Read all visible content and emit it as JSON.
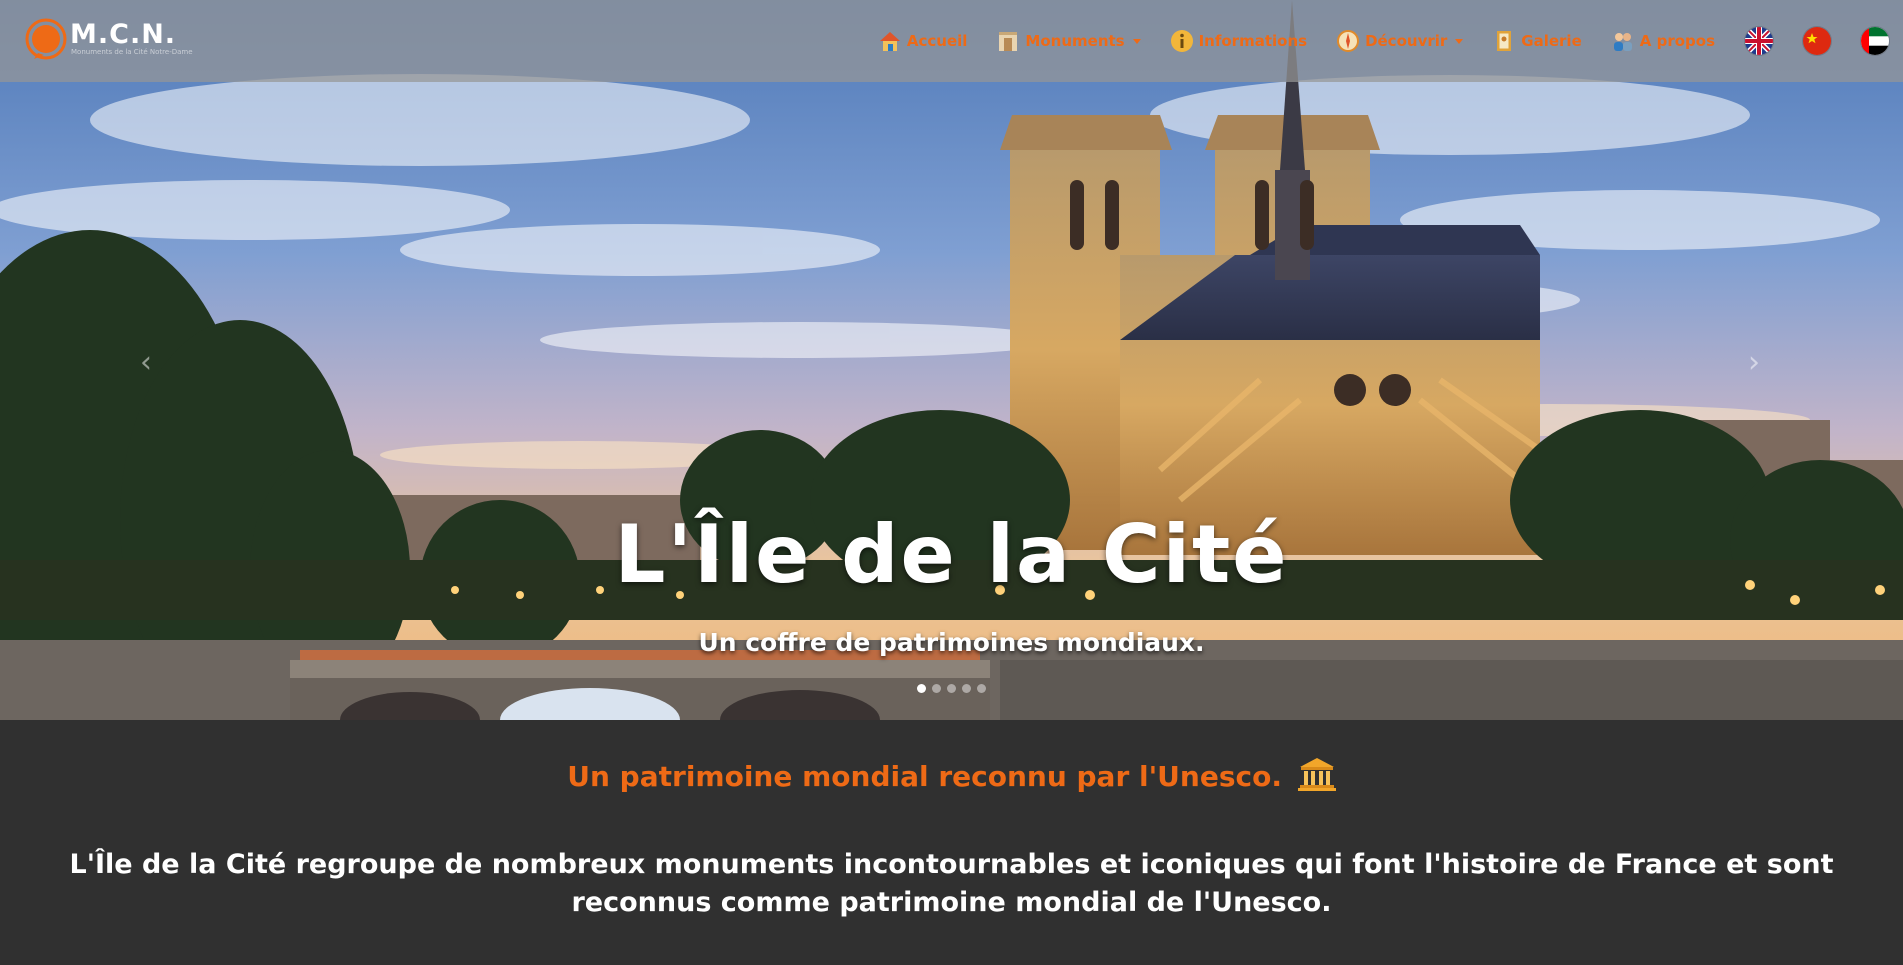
{
  "brand": {
    "name": "M.C.N.",
    "subtitle": "Monuments de la Cité Notre-Dame",
    "logo_icon": "orange-circle-logo-icon"
  },
  "nav": {
    "items": [
      {
        "label": "Accueil",
        "icon": "house-icon",
        "has_dropdown": false
      },
      {
        "label": "Monuments",
        "icon": "monument-icon",
        "has_dropdown": true
      },
      {
        "label": "Informations",
        "icon": "info-icon",
        "has_dropdown": false
      },
      {
        "label": "Découvrir",
        "icon": "compass-icon",
        "has_dropdown": true
      },
      {
        "label": "Galerie",
        "icon": "picture-frame-icon",
        "has_dropdown": false
      },
      {
        "label": "A propos",
        "icon": "people-icon",
        "has_dropdown": false
      }
    ],
    "flags": [
      "uk-flag-icon",
      "china-flag-icon",
      "uae-flag-icon"
    ],
    "accent_color": "#ee6a16"
  },
  "hero": {
    "title": "L'Île de la Cité",
    "subtitle": "Un coffre de patrimoines mondiaux.",
    "prev_arrow": "‹",
    "next_arrow": "›",
    "slide_count": 5,
    "active_slide": 1
  },
  "section": {
    "title": "Un patrimoine mondial reconnu par l'Unesco.",
    "title_icon": "temple-icon",
    "body": "L'Île de la Cité regroupe de nombreux monuments incontournables et iconiques qui font l'histoire de France et sont reconnus comme patrimoine mondial de l'Unesco.",
    "background_color": "#303030"
  }
}
